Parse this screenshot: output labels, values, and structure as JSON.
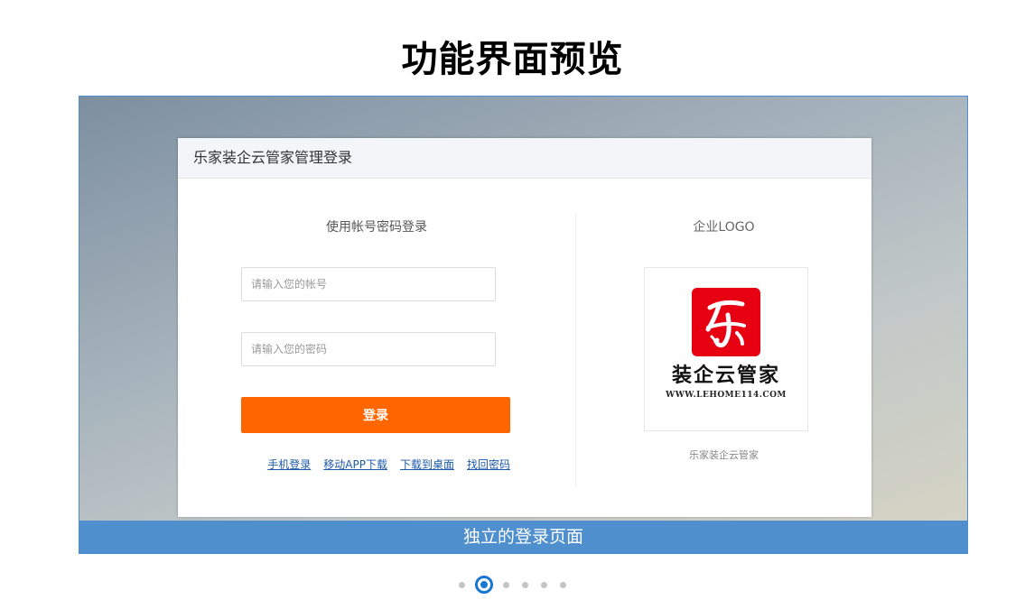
{
  "page": {
    "title": "功能界面预览"
  },
  "login": {
    "header_title": "乐家装企云管家管理登录",
    "section_title": "使用帐号密码登录",
    "account_placeholder": "请输入您的帐号",
    "password_placeholder": "请输入您的密码",
    "login_label": "登录",
    "button_color": "#ff6600",
    "links": [
      "手机登录",
      "移动APP下载",
      "下载到桌面",
      "找回密码"
    ]
  },
  "logo": {
    "section_title": "企业LOGO",
    "brand_name": "装企云管家",
    "url": "WWW.LEHOME114.COM",
    "mark_color": "#e60012",
    "company_name": "乐家装企云管家"
  },
  "slide": {
    "caption": "独立的登录页面",
    "caption_bar_color": "#4f8fcd"
  },
  "carousel": {
    "total": 6,
    "active_index": 1,
    "active_color": "#1976d2"
  }
}
